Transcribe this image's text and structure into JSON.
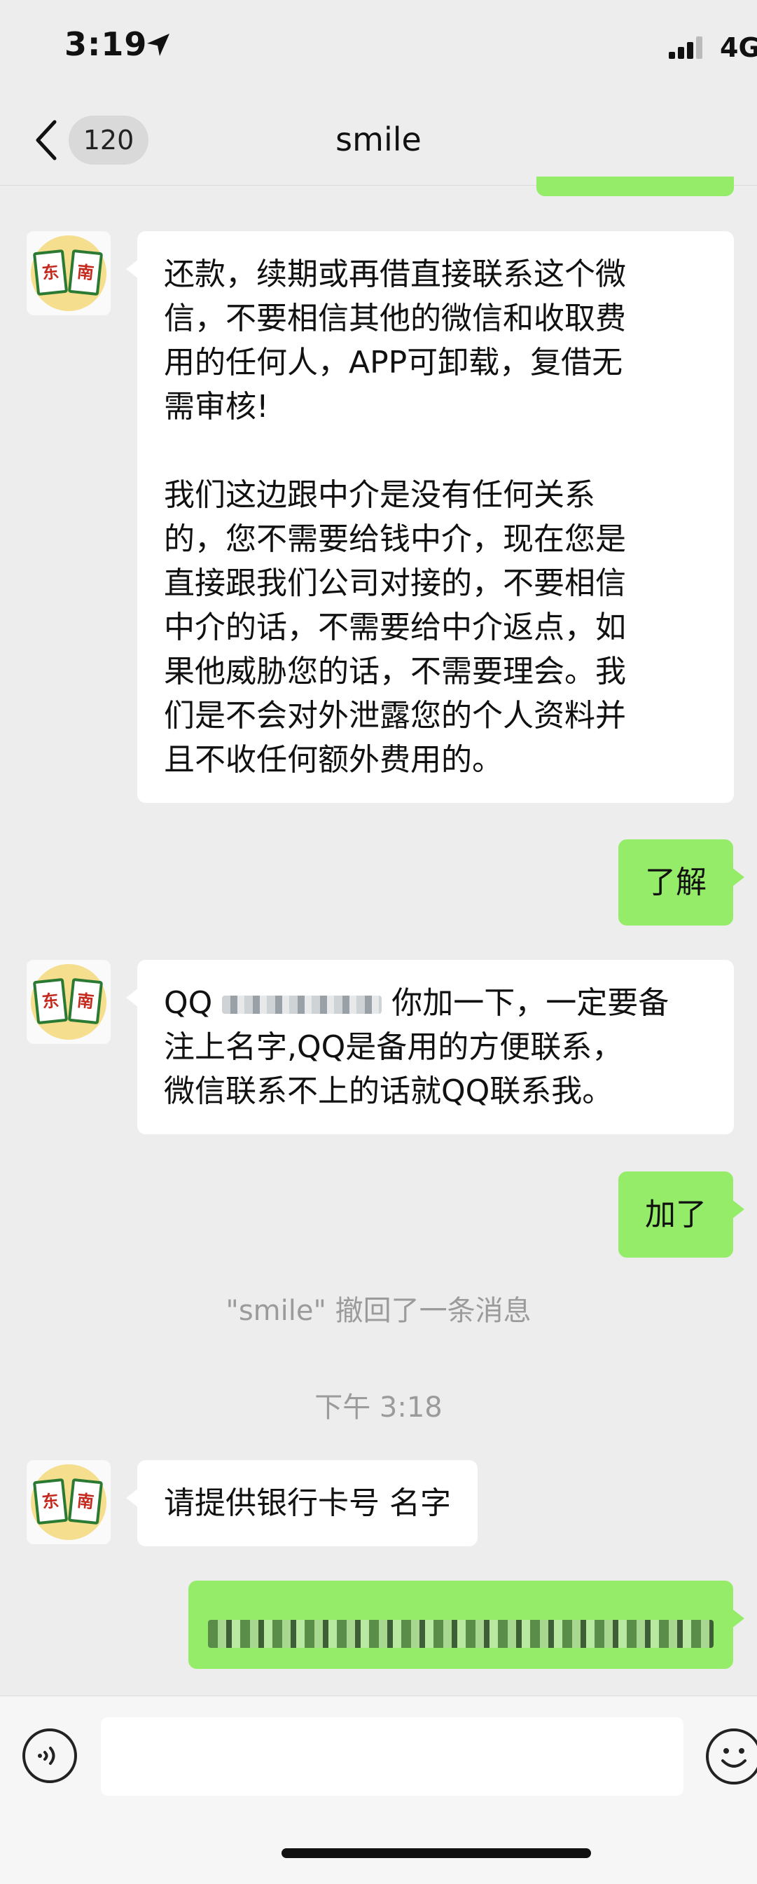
{
  "status_bar": {
    "time": "3:19",
    "network": "4G"
  },
  "nav": {
    "badge_count": "120",
    "title": "smile"
  },
  "avatar_text": [
    "东",
    "南"
  ],
  "messages": {
    "m1_p1": [
      "还款，续期或再借直接联系这个微",
      "信，不要相信其他的微信和收取费",
      "用的任何人，APP可卸载，复借无",
      "需审核!"
    ],
    "m1_p2": [
      "我们这边跟中介是没有任何关系",
      "的，您不需要给钱中介，现在您是",
      "直接跟我们公司对接的，不要相信",
      "中介的话，不需要给中介返点，如",
      "果他威胁您的话，不需要理会。我",
      "们是不会对外泄露您的个人资料并",
      "且不收任何额外费用的。"
    ],
    "m2": "了解",
    "m3_prefix": "QQ",
    "m3_line1_rest": "你加一下，一定要备",
    "m3_lines": [
      "注上名字,QQ是备用的方便联系，",
      "微信联系不上的话就QQ联系我。"
    ],
    "m4": "加了",
    "recall_notice": "\"smile\" 撤回了一条消息",
    "timestamp": "下午 3:18",
    "m5": "请提供银行卡号 名字"
  },
  "icons": {
    "back": "chevron-left-icon",
    "location": "location-arrow-icon",
    "signal": "signal-bars-icon",
    "voice": "voice-input-icon",
    "emoji": "emoji-icon"
  },
  "colors": {
    "outgoing_bubble": "#95ec69",
    "incoming_bubble": "#ffffff",
    "background": "#ededed"
  }
}
